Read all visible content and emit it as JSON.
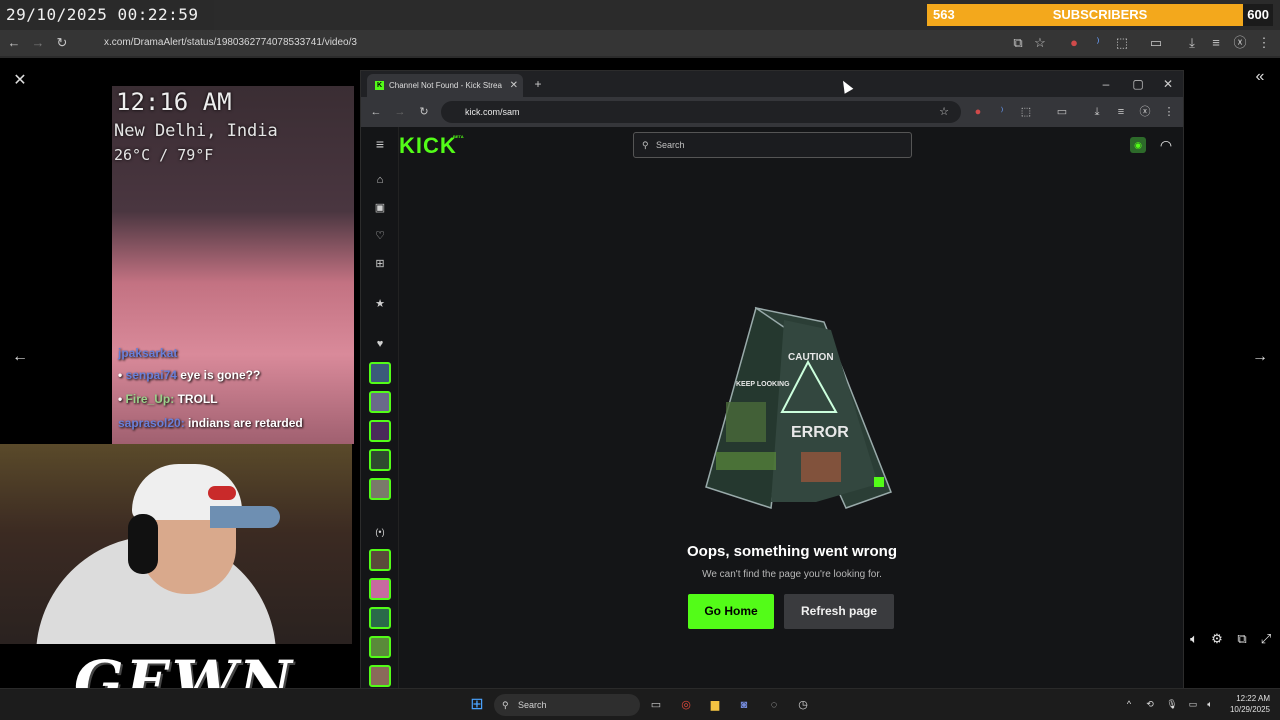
{
  "overlay": {
    "timestamp": "29/10/2025 00:22:59",
    "subscribers_count": "563",
    "subscribers_label": "SUBSCRIBERS",
    "subscribers_goal": "600",
    "accent_color": "#f3a81c"
  },
  "outer_browser": {
    "url": "x.com/DramaAlert/status/1980362774078533741/video/3"
  },
  "stream": {
    "clock": "12:16 AM",
    "location": "New Delhi, India",
    "temperature": "26°C / 79°F",
    "chat": [
      {
        "user": "jpaksarkat",
        "text": ""
      },
      {
        "user": "senpai74",
        "text": "eye is gone??"
      },
      {
        "user": "Fire_Up:",
        "text": "TROLL"
      },
      {
        "user": "saprasol20:",
        "text": "indians are retarded"
      }
    ],
    "watermark": "GEWN"
  },
  "inner_browser": {
    "tab_title": "Channel Not Found - Kick Strea",
    "url": "kick.com/sam"
  },
  "kick": {
    "logo": "KICK",
    "beta": "BETA",
    "brand_color": "#53fc18",
    "search_placeholder": "Search",
    "error_title": "Oops, something went wrong",
    "error_subtitle": "We can't find the page you're looking for.",
    "go_home_label": "Go Home",
    "refresh_label": "Refresh page",
    "sign_text": {
      "caution": "CAUTION",
      "error": "ERROR",
      "keep": "KEEP LOOKING"
    }
  },
  "taskbar": {
    "search_placeholder": "Search",
    "time": "12:22 AM",
    "date": "10/29/2025"
  }
}
